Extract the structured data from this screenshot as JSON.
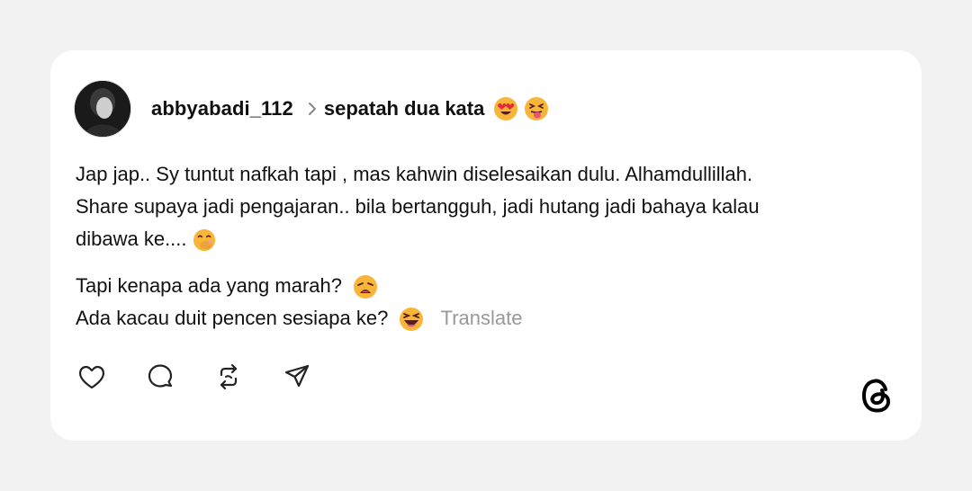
{
  "post": {
    "username": "abbyabadi_112",
    "topic": "sepatah dua kata",
    "topic_emojis": [
      "heart-eyes-emoji",
      "squinting-tongue-emoji"
    ],
    "paragraph1": {
      "line1": "Jap jap.. Sy tuntut nafkah tapi , mas kahwin diselesaikan dulu. Alhamdullillah.",
      "line2": "Share supaya jadi pengajaran.. bila bertangguh, jadi hutang jadi bahaya kalau",
      "line3": "dibawa ke...."
    },
    "paragraph2": {
      "line1": "Tapi kenapa ada yang marah?",
      "line2": "Ada kacau duit pencen sesiapa ke?"
    },
    "translate_label": "Translate"
  },
  "actions": {
    "icons": [
      "heart-icon",
      "comment-icon",
      "repost-icon",
      "share-icon"
    ]
  },
  "brand": {
    "logo": "threads-logo-icon"
  },
  "colors": {
    "background": "#f2f2f2",
    "card": "#ffffff",
    "text": "#111111",
    "muted": "#999999"
  }
}
